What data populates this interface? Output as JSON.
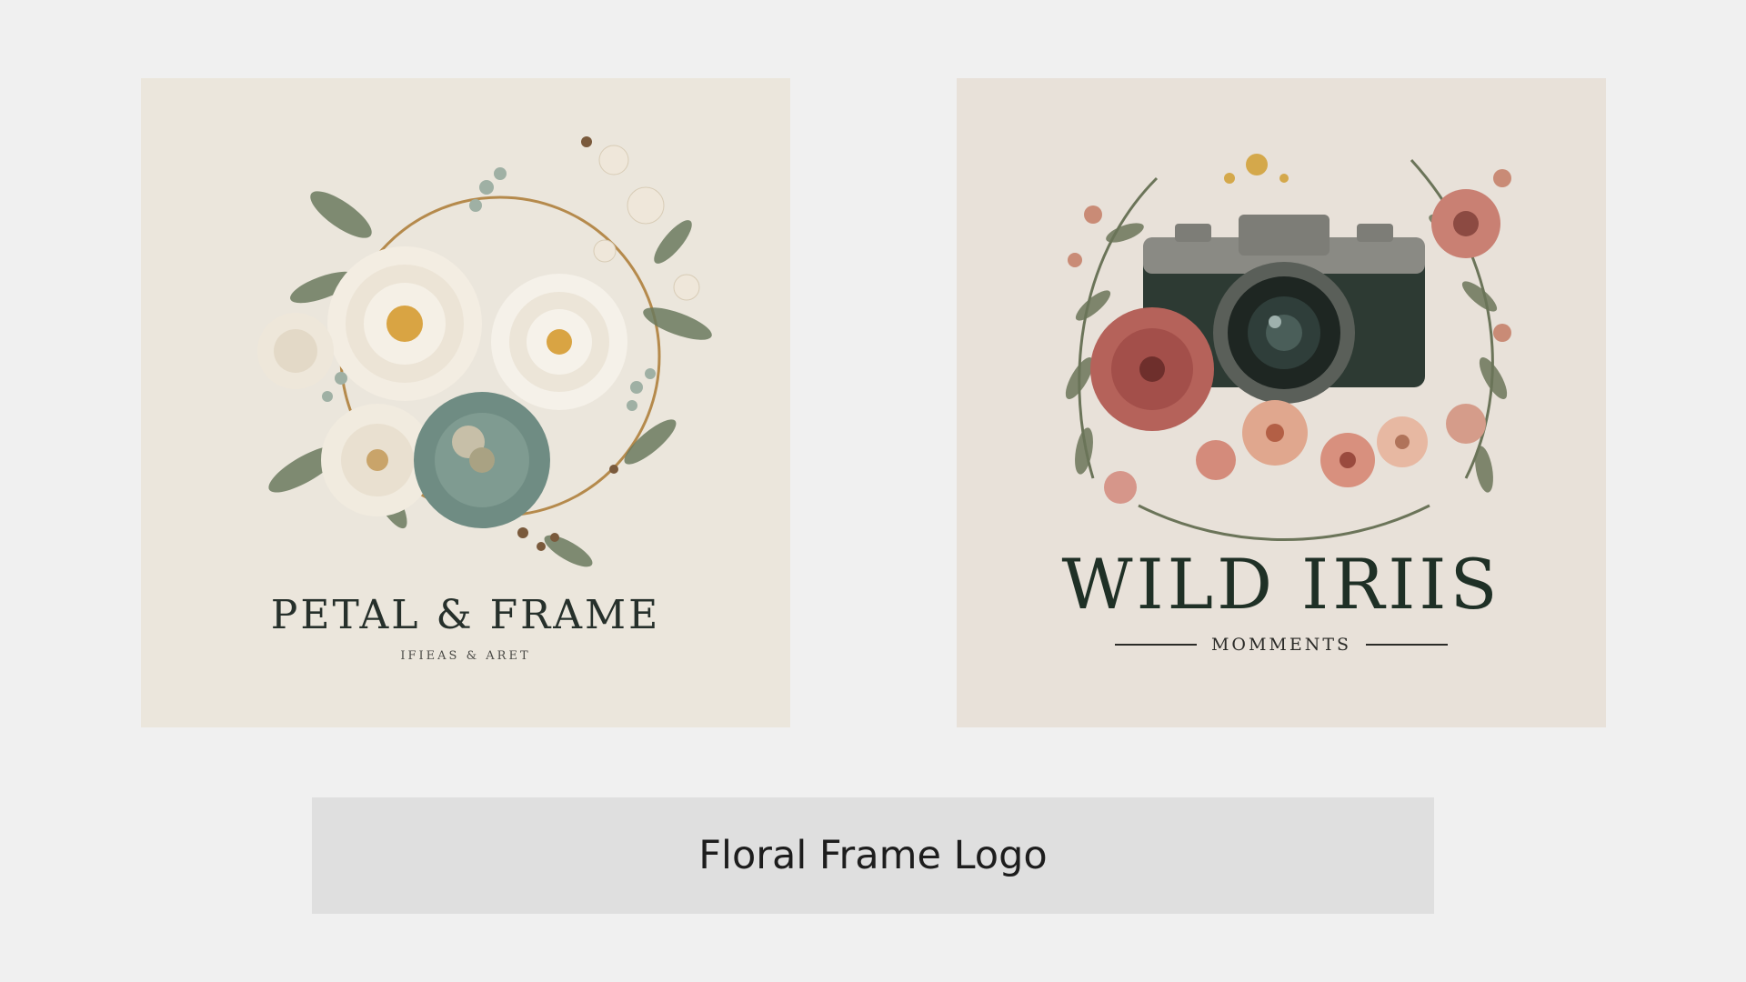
{
  "left_logo": {
    "title": "PETAL & FRAME",
    "tagline": "IFIEAS & ARET",
    "colors": {
      "background": "#ebe6dc",
      "ring": "#b58a4c",
      "cream_petal": "#f3ede2",
      "sage_flower": "#6f8c83",
      "leaf": "#6b7a5e",
      "text": "#26302b"
    }
  },
  "right_logo": {
    "title": "WILD IRIIS",
    "tagline": "MOMMENTS",
    "colors": {
      "background": "#e8e1d9",
      "camera_body": "#2d3a33",
      "camera_top": "#8a8a84",
      "flower": "#b5625a",
      "leaf": "#6b7459",
      "text": "#1f3026"
    }
  },
  "caption": {
    "label": "Floral Frame Logo"
  }
}
